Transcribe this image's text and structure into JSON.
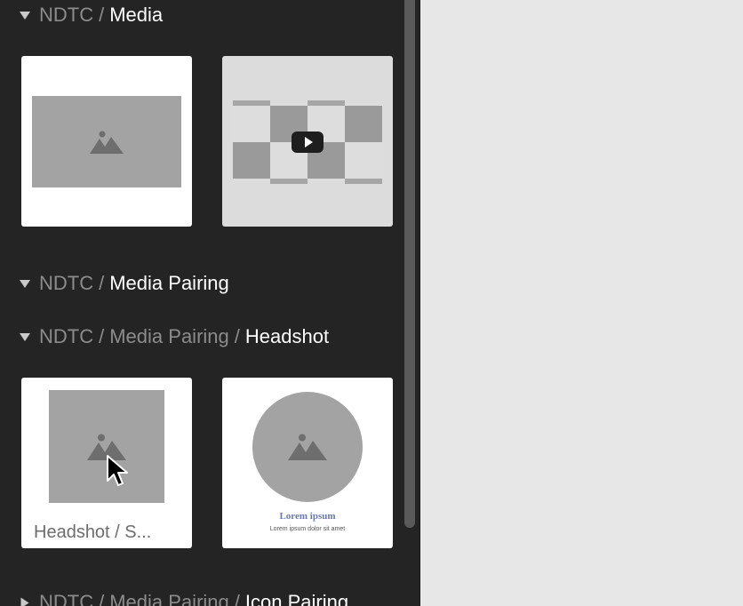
{
  "sections": [
    {
      "root": "NDTC",
      "mid": "",
      "current": "Media"
    },
    {
      "root": "NDTC",
      "mid": "",
      "current": "Media Pairing"
    },
    {
      "root": "NDTC",
      "mid": "Media Pairing",
      "current": "Headshot"
    },
    {
      "root": "NDTC",
      "mid": "Media Pairing",
      "current": "Icon Pairing"
    }
  ],
  "separator": "/",
  "cards": {
    "headshot_label": "Headshot / S...",
    "lorem_title": "Lorem ipsum",
    "lorem_sub": "Lorem ipsum dolor sit amet"
  },
  "icons": [
    "caret-down-icon",
    "image-placeholder-icon",
    "play-icon",
    "cursor-icon"
  ],
  "colors": {
    "panel": "#242424",
    "canvas": "#e7e7e7",
    "placeholder": "#a3a3a3"
  }
}
